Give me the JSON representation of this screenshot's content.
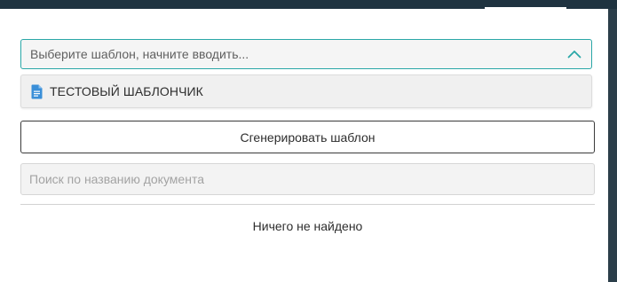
{
  "template_select": {
    "placeholder": "Выберите шаблон, начните вводить...",
    "expanded": true,
    "options": [
      {
        "label": "ТЕСТОВЫЙ ШАБЛОНЧИК",
        "icon": "document-icon"
      }
    ]
  },
  "generate_button": {
    "label": "Сгенерировать шаблон"
  },
  "document_search": {
    "value": "",
    "placeholder": "Поиск по названию документа"
  },
  "results": {
    "empty_message": "Ничего не найдено"
  },
  "colors": {
    "accent": "#2aa7a7",
    "header_dark": "#1f3340",
    "doc_icon": "#3a8fd8"
  }
}
